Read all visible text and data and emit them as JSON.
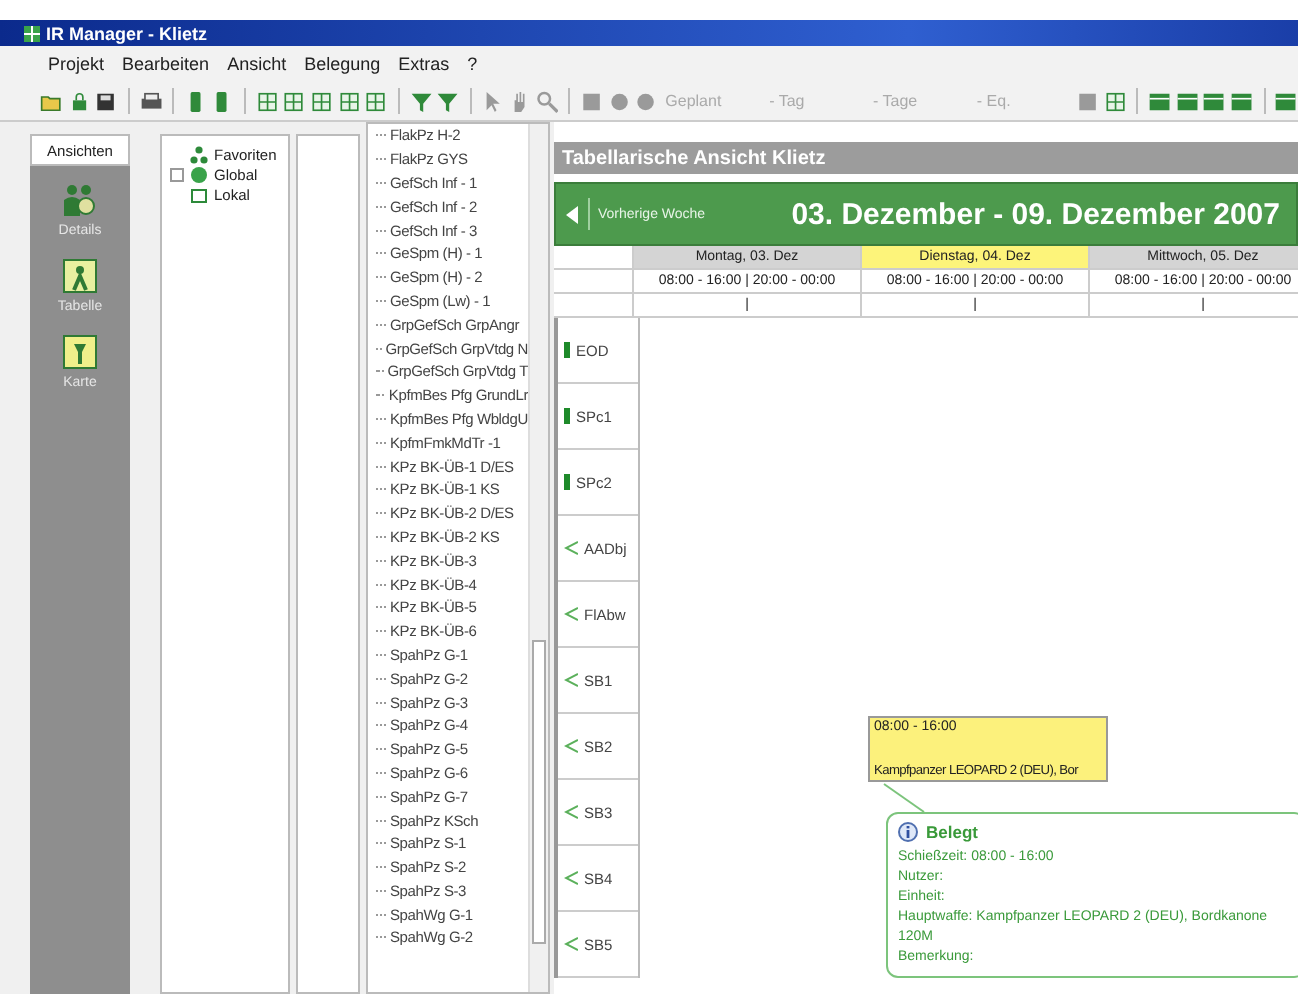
{
  "window": {
    "title": "IR Manager - Klietz"
  },
  "menu": [
    "Projekt",
    "Bearbeiten",
    "Ansicht",
    "Belegung",
    "Extras",
    "?"
  ],
  "toolbar": {
    "combos": [
      {
        "text": "Geplant",
        "disabled": true
      },
      {
        "text": "- Tag",
        "disabled": true
      },
      {
        "text": "- Tage",
        "disabled": true
      },
      {
        "text": "- Eq.",
        "disabled": true
      }
    ]
  },
  "views_panel": {
    "title": "Ansichten",
    "items": [
      {
        "label": "Details",
        "kind": "details"
      },
      {
        "label": "Tabelle",
        "kind": "table"
      },
      {
        "label": "Karte",
        "kind": "map"
      }
    ]
  },
  "tree": [
    {
      "label": "Favoriten",
      "kind": "favorites",
      "expandable": false
    },
    {
      "label": "Global",
      "kind": "global",
      "expandable": true
    },
    {
      "label": "Lokal",
      "kind": "local",
      "expandable": false
    }
  ],
  "resource_list": [
    "FlakPz H-2",
    "FlakPz GYS",
    "GefSch Inf - 1",
    "GefSch Inf - 2",
    "GefSch Inf - 3",
    "GeSpm (H) - 1",
    "GeSpm (H) - 2",
    "GeSpm (Lw) - 1",
    "GrpGefSch GrpAngr",
    "GrpGefSch GrpVtdg N",
    "GrpGefSch GrpVtdg T",
    "KpfmBes Pfg GrundLr",
    "KpfmBes Pfg WbldgU",
    "KpfmFmkMdTr -1",
    "KPz BK-ÜB-1 D/ES",
    "KPz BK-ÜB-1 KS",
    "KPz BK-ÜB-2 D/ES",
    "KPz BK-ÜB-2 KS",
    "KPz BK-ÜB-3",
    "KPz BK-ÜB-4",
    "KPz BK-ÜB-5",
    "KPz BK-ÜB-6",
    "SpahPz G-1",
    "SpahPz G-2",
    "SpahPz G-3",
    "SpahPz G-4",
    "SpahPz G-5",
    "SpahPz G-6",
    "SpahPz G-7",
    "SpahPz KSch",
    "SpahPz S-1",
    "SpahPz S-2",
    "SpahPz S-3",
    "SpahWg G-1",
    "SpahWg G-2"
  ],
  "schedule": {
    "title": "Tabellarische Ansicht Klietz",
    "previous_week": "Vorherige Woche",
    "range": "03. Dezember - 09. Dezember 2007",
    "days": [
      {
        "label": "Montag, 03. Dez",
        "times": "08:00 - 16:00 | 20:00 - 00:00",
        "marker": "|",
        "selected": false
      },
      {
        "label": "Dienstag, 04. Dez",
        "times": "08:00 - 16:00 | 20:00 - 00:00",
        "marker": "|",
        "selected": true
      },
      {
        "label": "Mittwoch, 05. Dez",
        "times": "08:00 - 16:00 | 20:00 - 00:00",
        "marker": "|",
        "selected": false
      }
    ],
    "rows": [
      {
        "label": "EOD",
        "kind": "bar"
      },
      {
        "label": "SPc1",
        "kind": "bar"
      },
      {
        "label": "SPc2",
        "kind": "bar"
      },
      {
        "label": "AADbj",
        "kind": "branch"
      },
      {
        "label": "FlAbw",
        "kind": "branch"
      },
      {
        "label": "SB1",
        "kind": "branch"
      },
      {
        "label": "SB2",
        "kind": "branch"
      },
      {
        "label": "SB3",
        "kind": "branch"
      },
      {
        "label": "SB4",
        "kind": "branch"
      },
      {
        "label": "SB5",
        "kind": "branch"
      }
    ],
    "booking": {
      "time": "08:00 - 16:00",
      "text": "Kampfpanzer LEOPARD 2 (DEU), Bor"
    },
    "tooltip": {
      "title": "Belegt",
      "lines": [
        "Schießzeit: 08:00 - 16:00",
        "Nutzer:",
        "Einheit:",
        "Hauptwaffe: Kampfpanzer LEOPARD 2 (DEU), Bordkanone 120M",
        "Bemerkung:"
      ]
    }
  }
}
